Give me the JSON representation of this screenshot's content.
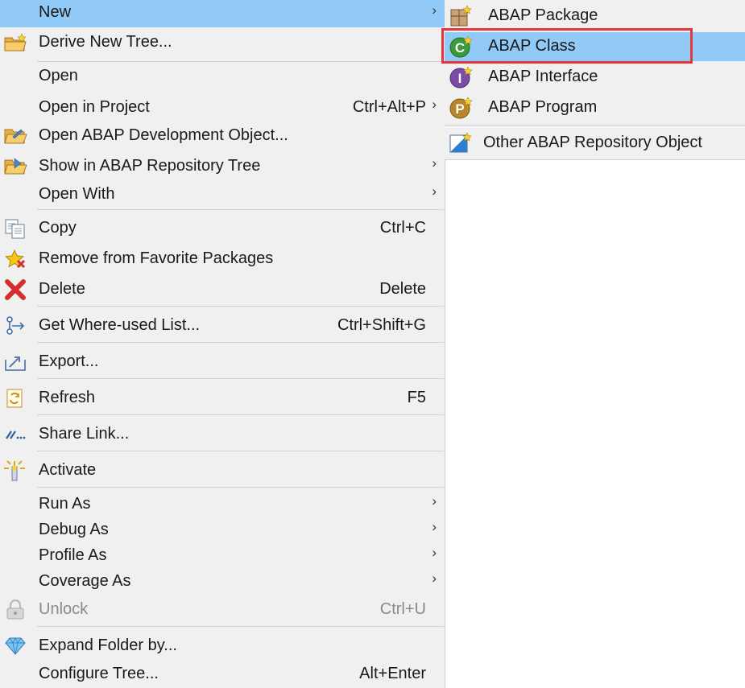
{
  "menu": {
    "new": {
      "label": "New"
    },
    "derive": {
      "label": "Derive New Tree..."
    },
    "open": {
      "label": "Open"
    },
    "open_in_project": {
      "label": "Open in Project",
      "shortcut": "Ctrl+Alt+P"
    },
    "open_abap_dev": {
      "label": "Open ABAP Development Object..."
    },
    "show_in_tree": {
      "label": "Show in ABAP Repository Tree"
    },
    "open_with": {
      "label": "Open With"
    },
    "copy": {
      "label": "Copy",
      "shortcut": "Ctrl+C"
    },
    "remove_fav": {
      "label": "Remove from Favorite Packages"
    },
    "delete": {
      "label": "Delete",
      "shortcut": "Delete"
    },
    "where_used": {
      "label": "Get Where-used List...",
      "shortcut": "Ctrl+Shift+G"
    },
    "export": {
      "label": "Export..."
    },
    "refresh": {
      "label": "Refresh",
      "shortcut": "F5"
    },
    "share_link": {
      "label": "Share Link..."
    },
    "activate": {
      "label": "Activate"
    },
    "run_as": {
      "label": "Run As"
    },
    "debug_as": {
      "label": "Debug As"
    },
    "profile_as": {
      "label": "Profile As"
    },
    "coverage_as": {
      "label": "Coverage As"
    },
    "unlock": {
      "label": "Unlock",
      "shortcut": "Ctrl+U"
    },
    "expand_folder": {
      "label": "Expand Folder by..."
    },
    "configure_tree": {
      "label": "Configure Tree...",
      "shortcut": "Alt+Enter"
    }
  },
  "submenu": {
    "package": {
      "label": "ABAP Package"
    },
    "class": {
      "label": "ABAP Class"
    },
    "interface": {
      "label": "ABAP Interface"
    },
    "program": {
      "label": "ABAP Program"
    },
    "other": {
      "label": "Other ABAP Repository Object"
    }
  },
  "icons": {
    "new": "none",
    "derive": "folder-new-icon",
    "open_abap_dev": "folder-open-icon",
    "show_in_tree": "folder-tree-icon",
    "copy": "copy-icon",
    "remove_fav": "star-remove-icon",
    "delete": "delete-x-icon",
    "where_used": "where-used-icon",
    "export": "export-icon",
    "refresh": "refresh-icon",
    "share_link": "share-link-icon",
    "activate": "activate-wand-icon",
    "unlock": "lock-icon",
    "expand_folder": "diamond-icon",
    "package": "package-icon",
    "class": "class-c-icon",
    "interface": "interface-i-icon",
    "program": "program-p-icon",
    "other": "repository-object-icon"
  },
  "colors": {
    "menu_bg": "#f0f0f0",
    "highlight": "#91c9f7",
    "focus_border": "#e5373a",
    "separator": "#d2d2d2",
    "disabled_text": "#8a8a8a"
  }
}
